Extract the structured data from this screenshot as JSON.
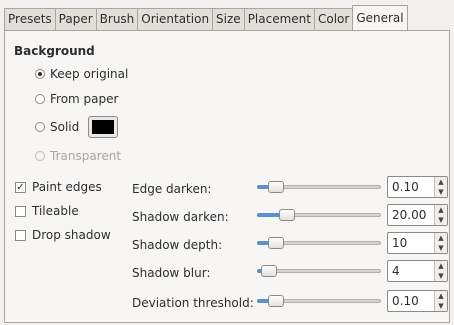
{
  "tabs": [
    {
      "label": "Presets",
      "active": false
    },
    {
      "label": "Paper",
      "active": false
    },
    {
      "label": "Brush",
      "active": false
    },
    {
      "label": "Orientation",
      "active": false
    },
    {
      "label": "Size",
      "active": false
    },
    {
      "label": "Placement",
      "active": false
    },
    {
      "label": "Color",
      "active": false
    },
    {
      "label": "General",
      "active": true
    }
  ],
  "background": {
    "title": "Background",
    "options": [
      {
        "label": "Keep original",
        "selected": true,
        "enabled": true
      },
      {
        "label": "From paper",
        "selected": false,
        "enabled": true
      },
      {
        "label": "Solid",
        "selected": false,
        "enabled": true
      },
      {
        "label": "Transparent",
        "selected": false,
        "enabled": false
      }
    ],
    "solid_color": "#000000"
  },
  "checkboxes": [
    {
      "label": "Paint edges",
      "checked": true
    },
    {
      "label": "Tileable",
      "checked": false
    },
    {
      "label": "Drop shadow",
      "checked": false
    }
  ],
  "sliders": [
    {
      "label": "Edge darken:",
      "value": "0.10",
      "level": 0.1
    },
    {
      "label": "Shadow darken:",
      "value": "20.00",
      "level": 0.2
    },
    {
      "label": "Shadow depth:",
      "value": "10",
      "level": 0.1
    },
    {
      "label": "Shadow blur:",
      "value": "4",
      "level": 0.04
    },
    {
      "label": "Deviation threshold:",
      "value": "0.10",
      "level": 0.1
    }
  ],
  "accent_color": "#5b8fcf"
}
